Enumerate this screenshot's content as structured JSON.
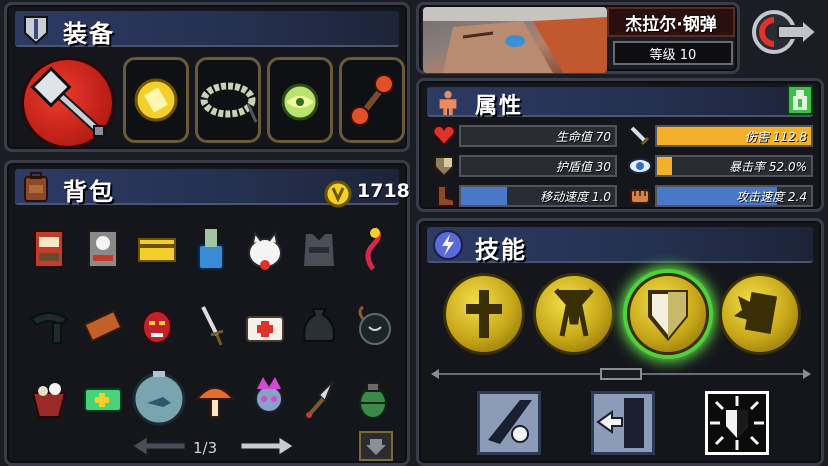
{
  "equipment": {
    "title": "装备",
    "slots": [
      "mace",
      "gold-coin",
      "bead-bracelet",
      "green-orb",
      "red-dumbbell"
    ]
  },
  "character": {
    "name": "杰拉尔·钢弹",
    "level": "等级 10"
  },
  "attributes": {
    "title": "属性",
    "stats": [
      {
        "label": "生命值 70",
        "fill": 0.0,
        "color": "#4a78c8"
      },
      {
        "label": "伤害 112.8",
        "fill": 1.0,
        "color": "#f2b02a"
      },
      {
        "label": "护盾值 30",
        "fill": 0.0,
        "color": "#4a78c8"
      },
      {
        "label": "暴击率 52.0%",
        "fill": 0.1,
        "color": "#f2b02a"
      },
      {
        "label": "移动速度 1.0",
        "fill": 0.3,
        "color": "#4a78c8"
      },
      {
        "label": "攻击速度 2.4",
        "fill": 0.78,
        "color": "#4a78c8"
      }
    ]
  },
  "backpack": {
    "title": "背包",
    "gold": "1718",
    "page": "1/3"
  },
  "skills": {
    "title": "技能"
  },
  "colors": {
    "panel_bg": "#15161c",
    "header_blue": "#2d3a63",
    "gold": "#f2b02a",
    "select_green": "#4dd23b"
  }
}
